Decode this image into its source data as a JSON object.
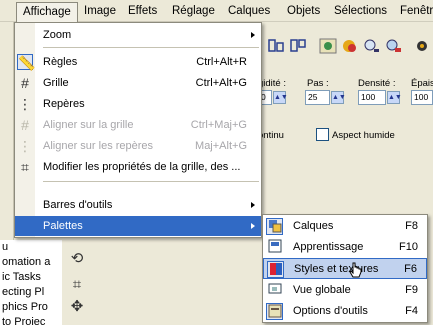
{
  "menubar": {
    "items": [
      {
        "label": "Affichage",
        "active": true
      },
      {
        "label": "Image"
      },
      {
        "label": "Effets"
      },
      {
        "label": "Réglage"
      },
      {
        "label": "Calques"
      },
      {
        "label": "Objets"
      },
      {
        "label": "Sélections"
      },
      {
        "label": "Fenêtre"
      }
    ]
  },
  "options_bar": {
    "labels": [
      "gidité :",
      "Pas :",
      "Densité :",
      "Épais"
    ],
    "values": [
      "0",
      "25",
      "100",
      "100"
    ],
    "continu": "ontinu",
    "aspect_humide": "Aspect humide"
  },
  "task_list": {
    "items": [
      "u",
      "omation a",
      "ic Tasks",
      "ecting Pl",
      "phics Pro",
      "to Projec"
    ]
  },
  "menu": {
    "items": [
      {
        "label": "Zoom",
        "shortcut": "",
        "submenu": true,
        "icon": "blank"
      },
      {
        "label": "Règles",
        "shortcut": "Ctrl+Alt+R",
        "icon": "rulers-icon"
      },
      {
        "label": "Grille",
        "shortcut": "Ctrl+Alt+G",
        "icon": "grid-icon"
      },
      {
        "label": "Repères",
        "shortcut": "",
        "icon": "guides-icon"
      },
      {
        "label": "Aligner sur la grille",
        "shortcut": "Ctrl+Maj+G",
        "icon": "snap-grid-icon",
        "disabled": true
      },
      {
        "label": "Aligner sur les repères",
        "shortcut": "Maj+Alt+G",
        "icon": "snap-guides-icon",
        "disabled": true
      },
      {
        "label": "Modifier les propriétés de la grille, des ...",
        "shortcut": "",
        "icon": "grid-properties-icon"
      },
      {
        "label": "Barres d'outils",
        "shortcut": "",
        "submenu": true,
        "icon": "blank"
      },
      {
        "label": "Palettes",
        "shortcut": "",
        "submenu": true,
        "icon": "blank",
        "selected": true
      }
    ]
  },
  "submenu": {
    "items": [
      {
        "label": "Calques",
        "shortcut": "F8",
        "icon": "layers-palette-icon",
        "checked": true
      },
      {
        "label": "Apprentissage",
        "shortcut": "F10",
        "icon": "learning-center-icon",
        "checked": false
      },
      {
        "label": "Styles et textures",
        "shortcut": "F6",
        "icon": "materials-palette-icon",
        "checked": true,
        "hover": true
      },
      {
        "label": "Vue globale",
        "shortcut": "F9",
        "icon": "overview-icon",
        "checked": false
      },
      {
        "label": "Options d'outils",
        "shortcut": "F4",
        "icon": "tool-options-icon",
        "checked": true
      }
    ]
  },
  "colors": {
    "menu_highlight": "#316ac5",
    "submenu_hover": "#c1d2ee",
    "window_bg": "#ece9d8"
  }
}
